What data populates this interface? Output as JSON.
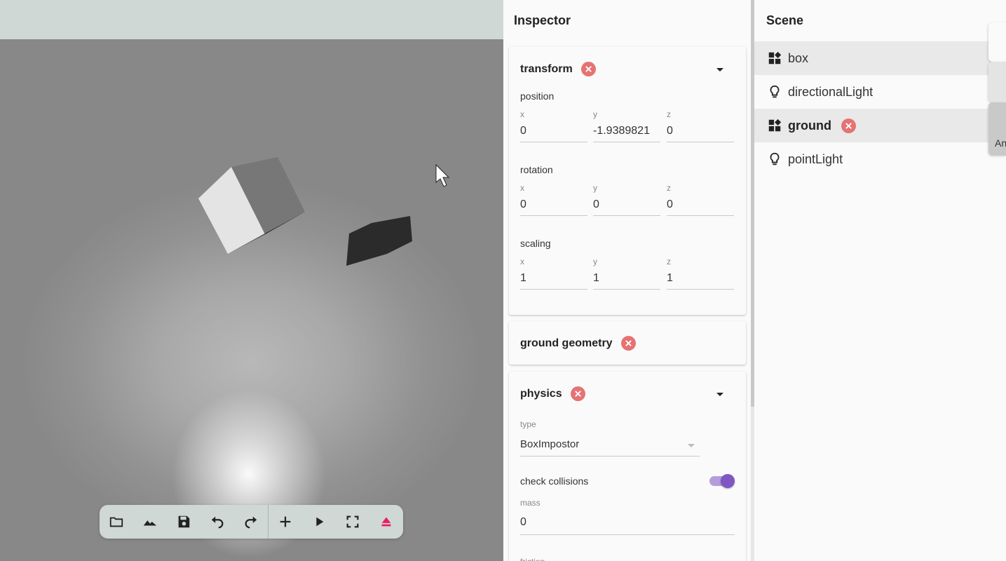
{
  "toolbar": {
    "buttons": [
      "open-folder-icon",
      "terrain-icon",
      "save-icon",
      "undo-icon",
      "redo-icon",
      "add-icon",
      "play-icon",
      "fullscreen-icon",
      "eject-icon"
    ],
    "eject_color": "#e91e63"
  },
  "inspector": {
    "title": "Inspector",
    "transform": {
      "title": "transform",
      "position": {
        "label": "position",
        "x_label": "x",
        "y_label": "y",
        "z_label": "z",
        "x": "0",
        "y": "-1.9389821",
        "z": "0"
      },
      "rotation": {
        "label": "rotation",
        "x_label": "x",
        "y_label": "y",
        "z_label": "z",
        "x": "0",
        "y": "0",
        "z": "0"
      },
      "scaling": {
        "label": "scaling",
        "x_label": "x",
        "y_label": "y",
        "z_label": "z",
        "x": "1",
        "y": "1",
        "z": "1"
      }
    },
    "geometry": {
      "title": "ground geometry"
    },
    "physics": {
      "title": "physics",
      "type_label": "type",
      "type_value": "BoxImpostor",
      "check_collisions_label": "check collisions",
      "check_collisions": true,
      "mass_label": "mass",
      "mass_value": "0",
      "friction_label": "friction"
    },
    "delete_color": "#e57373"
  },
  "scene": {
    "title": "Scene",
    "items": [
      {
        "name": "box",
        "icon": "widgets-icon",
        "selected": true
      },
      {
        "name": "directionalLight",
        "icon": "lightbulb-icon",
        "selected": false
      },
      {
        "name": "ground",
        "icon": "widgets-icon",
        "selected": true
      },
      {
        "name": "pointLight",
        "icon": "lightbulb-icon",
        "selected": false
      }
    ],
    "side_tab_text": "An"
  },
  "colors": {
    "accent": "#7e57c2",
    "accent_light": "#b39ddb",
    "topbar": "#cfd8d4"
  }
}
